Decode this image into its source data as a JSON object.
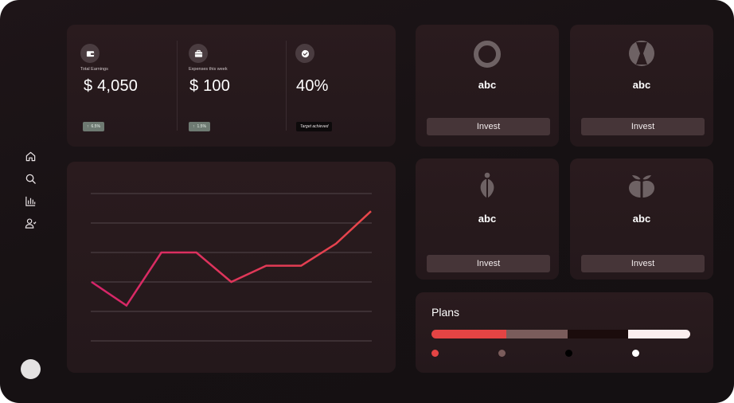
{
  "sidebar": {
    "items": [
      {
        "icon": "home-icon"
      },
      {
        "icon": "search-icon"
      },
      {
        "icon": "bar-chart-icon"
      },
      {
        "icon": "users-icon"
      }
    ]
  },
  "stats": [
    {
      "icon": "wallet-icon",
      "label": "Total Earnings",
      "value": "$ 4,050",
      "badge": "6.5%"
    },
    {
      "icon": "briefcase-icon",
      "label": "Expenses this week",
      "value": "$ 100",
      "badge": "1.5%"
    },
    {
      "icon": "check-icon",
      "label": "",
      "value": "40%",
      "badge": "Target achieved"
    }
  ],
  "chart_data": {
    "type": "line",
    "x": [
      0,
      1,
      2,
      3,
      4,
      5,
      6,
      7,
      8
    ],
    "series": [
      {
        "values": [
          2.0,
          1.2,
          3.0,
          3.0,
          2.0,
          2.55,
          2.55,
          3.3,
          4.4
        ]
      }
    ],
    "ylim": [
      0,
      5
    ],
    "grid": true,
    "line_color_start": "#d6246a",
    "line_color_end": "#e8474a"
  },
  "invest_cards": [
    {
      "icon": "ring-icon",
      "name": "abc",
      "button": "Invest"
    },
    {
      "icon": "hourglass-icon",
      "name": "abc",
      "button": "Invest"
    },
    {
      "icon": "split-drop-icon",
      "name": "abc",
      "button": "Invest"
    },
    {
      "icon": "apple-icon",
      "name": "abc",
      "button": "Invest"
    }
  ],
  "plans": {
    "title": "Plans",
    "segments": [
      {
        "share": 0.29,
        "color": "#e44444"
      },
      {
        "share": 0.235,
        "color": "#7a5c5b"
      },
      {
        "share": 0.235,
        "color": "#1b0c0c"
      },
      {
        "share": 0.24,
        "color": "#fbeeee"
      }
    ],
    "dots": [
      "#e44444",
      "#7a5c5b",
      "#000000",
      "#ffffff"
    ]
  },
  "colors": {
    "background": "#161113",
    "card": "#261a1d",
    "accent": "#e44444",
    "button": "#463538"
  }
}
